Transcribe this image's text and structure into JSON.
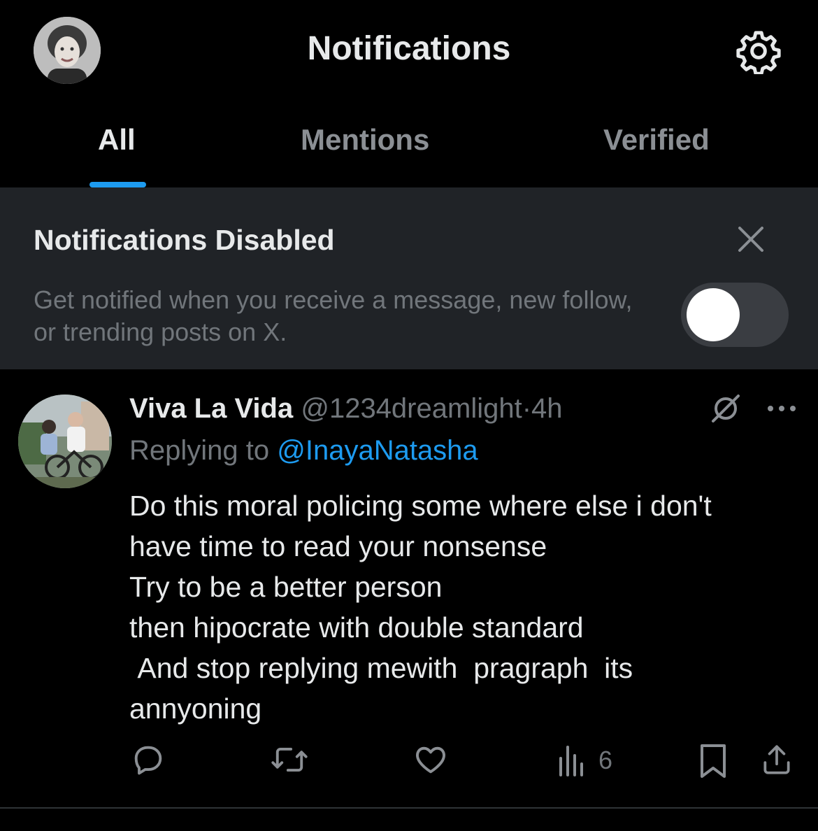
{
  "header": {
    "title": "Notifications",
    "avatar": "profile-avatar",
    "settings_icon": "gear-icon"
  },
  "tabs": [
    {
      "label": "All",
      "active": true
    },
    {
      "label": "Mentions",
      "active": false
    },
    {
      "label": "Verified",
      "active": false
    }
  ],
  "banner": {
    "title": "Notifications Disabled",
    "description": "Get notified when you receive a message, new follow, or trending posts on X.",
    "toggle_on": false,
    "close_icon": "close-icon"
  },
  "post": {
    "name": "Viva La Vida",
    "handle": "@1234dreamlight",
    "separator": "·",
    "time": "4h",
    "replying_prefix": "Replying to ",
    "replying_to": "@InayaNatasha",
    "text": "Do this moral policing some where else i don't\nhave time to read your nonsense\nTry to be a better person\nthen hipocrate with double standard\n And stop replying mewith  pragraph  its\nannyoning",
    "views": "6",
    "icons": [
      "grok-icon",
      "more-icon",
      "reply-icon",
      "repost-icon",
      "like-icon",
      "views-icon",
      "bookmark-icon",
      "share-icon"
    ]
  },
  "colors": {
    "background": "#000000",
    "accent": "#1d9bf0",
    "banner": "#202327",
    "muted": "#71767b"
  }
}
